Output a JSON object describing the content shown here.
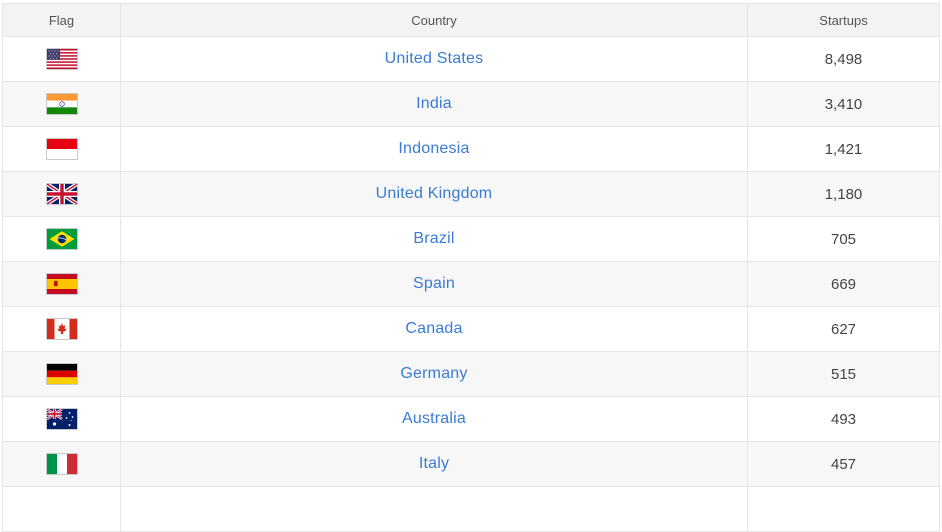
{
  "headers": {
    "flag": "Flag",
    "country": "Country",
    "startups": "Startups"
  },
  "rows": [
    {
      "country": "United States",
      "startups": "8,498",
      "flag_icon": "us-flag-icon"
    },
    {
      "country": "India",
      "startups": "3,410",
      "flag_icon": "india-flag-icon"
    },
    {
      "country": "Indonesia",
      "startups": "1,421",
      "flag_icon": "indonesia-flag-icon"
    },
    {
      "country": "United Kingdom",
      "startups": "1,180",
      "flag_icon": "uk-flag-icon"
    },
    {
      "country": "Brazil",
      "startups": "705",
      "flag_icon": "brazil-flag-icon"
    },
    {
      "country": "Spain",
      "startups": "669",
      "flag_icon": "spain-flag-icon"
    },
    {
      "country": "Canada",
      "startups": "627",
      "flag_icon": "canada-flag-icon"
    },
    {
      "country": "Germany",
      "startups": "515",
      "flag_icon": "germany-flag-icon"
    },
    {
      "country": "Australia",
      "startups": "493",
      "flag_icon": "australia-flag-icon"
    },
    {
      "country": "Italy",
      "startups": "457",
      "flag_icon": "italy-flag-icon"
    }
  ],
  "colors": {
    "link": "#3a7bd5",
    "header_bg": "#f3f3f3",
    "stripe_bg": "#f7f7f7",
    "border": "#e6e6e6"
  }
}
